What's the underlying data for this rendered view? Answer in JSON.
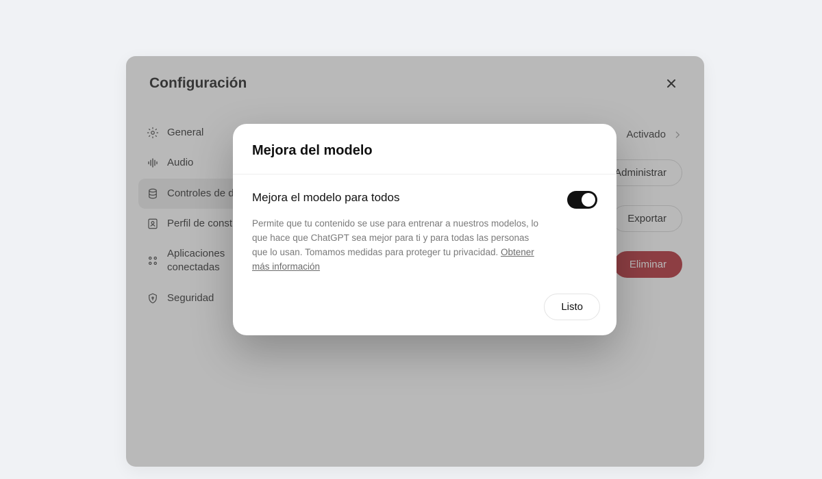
{
  "settings": {
    "title": "Configuración",
    "sidebar": [
      {
        "key": "general",
        "label": "General"
      },
      {
        "key": "audio",
        "label": "Audio"
      },
      {
        "key": "controls",
        "label": "Controles de datos",
        "active": true
      },
      {
        "key": "builder",
        "label": "Perfil de constructor"
      },
      {
        "key": "apps",
        "label": "Aplicaciones conectadas"
      },
      {
        "key": "security",
        "label": "Seguridad"
      }
    ],
    "rows": {
      "activated_value": "Activado",
      "manage_btn": "Administrar",
      "export_btn": "Exportar",
      "delete_btn": "Eliminar"
    }
  },
  "modal": {
    "title": "Mejora del modelo",
    "setting_label": "Mejora el modelo para todos",
    "toggle_on": true,
    "description": "Permite que tu contenido se use para entrenar a nuestros modelos, lo que hace que ChatGPT sea mejor para ti y para todas las personas que lo usan. Tomamos medidas para proteger tu privacidad. ",
    "learn_more": "Obtener más información",
    "done": "Listo"
  }
}
